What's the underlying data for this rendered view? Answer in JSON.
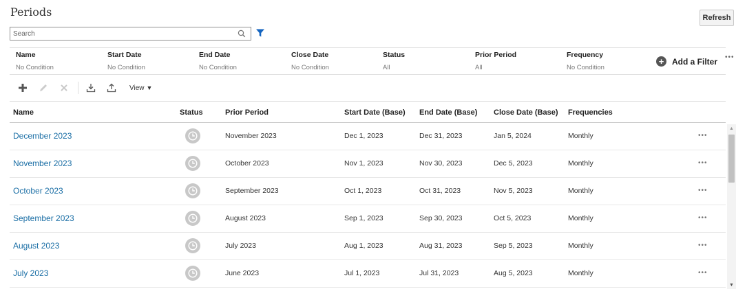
{
  "page": {
    "title": "Periods",
    "refresh_label": "Refresh"
  },
  "search": {
    "placeholder": "Search",
    "value": ""
  },
  "filters": [
    {
      "name": "Name",
      "value": "No Condition"
    },
    {
      "name": "Start Date",
      "value": "No Condition"
    },
    {
      "name": "End Date",
      "value": "No Condition"
    },
    {
      "name": "Close Date",
      "value": "No Condition"
    },
    {
      "name": "Status",
      "value": "All"
    },
    {
      "name": "Prior Period",
      "value": "All"
    },
    {
      "name": "Frequency",
      "value": "No Condition"
    }
  ],
  "add_filter_label": "Add a Filter",
  "more_label": "•••",
  "toolbar": {
    "view_label": "View"
  },
  "columns": [
    "Name",
    "Status",
    "Prior Period",
    "Start Date (Base)",
    "End Date (Base)",
    "Close Date (Base)",
    "Frequencies"
  ],
  "rows": [
    {
      "name": "December 2023",
      "prior": "November 2023",
      "start": "Dec 1, 2023",
      "end": "Dec 31, 2023",
      "close": "Jan 5, 2024",
      "freq": "Monthly",
      "more": "•••"
    },
    {
      "name": "November 2023",
      "prior": "October 2023",
      "start": "Nov 1, 2023",
      "end": "Nov 30, 2023",
      "close": "Dec 5, 2023",
      "freq": "Monthly",
      "more": "•••"
    },
    {
      "name": "October 2023",
      "prior": "September 2023",
      "start": "Oct 1, 2023",
      "end": "Oct 31, 2023",
      "close": "Nov 5, 2023",
      "freq": "Monthly",
      "more": "•••"
    },
    {
      "name": "September 2023",
      "prior": "August 2023",
      "start": "Sep 1, 2023",
      "end": "Sep 30, 2023",
      "close": "Oct 5, 2023",
      "freq": "Monthly",
      "more": "•••"
    },
    {
      "name": "August 2023",
      "prior": "July 2023",
      "start": "Aug 1, 2023",
      "end": "Aug 31, 2023",
      "close": "Sep 5, 2023",
      "freq": "Monthly",
      "more": "•••"
    },
    {
      "name": "July 2023",
      "prior": "June 2023",
      "start": "Jul 1, 2023",
      "end": "Jul 31, 2023",
      "close": "Aug 5, 2023",
      "freq": "Monthly",
      "more": "•••"
    }
  ],
  "colors": {
    "link": "#1a6ea5",
    "filter_icon": "#1565c0",
    "status_icon": "#c8c8c8"
  }
}
